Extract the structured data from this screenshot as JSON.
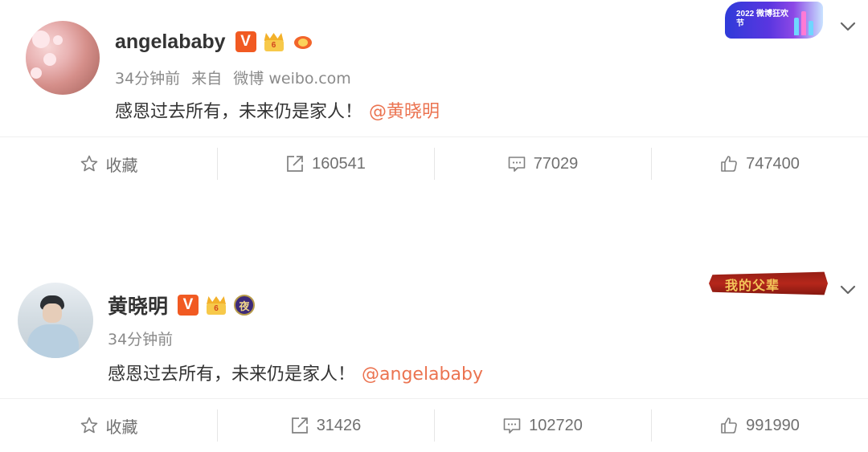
{
  "posts": [
    {
      "username": "angelababy",
      "verified_badge": "V",
      "crown_badge_text": "6",
      "time": "34分钟前",
      "source_prefix": "来自",
      "source": "微博 weibo.com",
      "content_text": "感恩过去所有，未来仍是家人！",
      "mention": "@黄晓明",
      "banner_icon": "2022-year-end-carnival-banner-icon",
      "banner_text": "2022 微博狂欢节",
      "actions": {
        "favorite_label": "收藏",
        "repost_count": "160541",
        "comment_count": "77029",
        "like_count": "747400"
      }
    },
    {
      "username": "黄晓明",
      "verified_badge": "V",
      "crown_badge_text": "6",
      "night_badge": "夜",
      "time": "34分钟前",
      "content_text": "感恩过去所有，未来仍是家人！",
      "mention": "@angelababy",
      "banner_icon": "my-father-banner-icon",
      "banner_text": "我的父辈",
      "actions": {
        "favorite_label": "收藏",
        "repost_count": "31426",
        "comment_count": "102720",
        "like_count": "991990"
      }
    }
  ],
  "colors": {
    "username": "#333333",
    "meta": "#8a8a8a",
    "mention": "#eb7350",
    "verified": "#f15a22",
    "toolbar_text": "#707070"
  }
}
